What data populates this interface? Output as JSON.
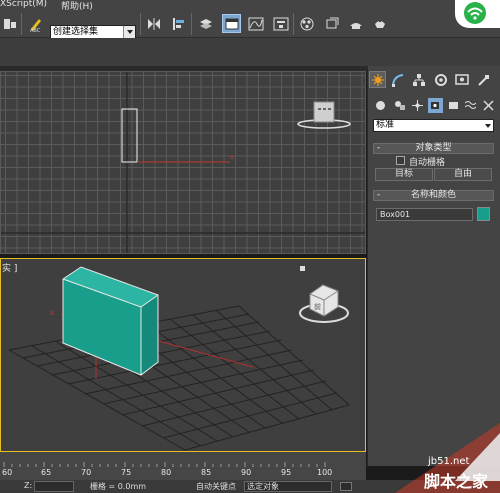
{
  "menu": {
    "items": [
      "XScript(M)",
      "帮助(H)"
    ]
  },
  "toolbar": {
    "selection_set_placeholder": "创建选择集"
  },
  "viewports": {
    "top": {
      "label": ""
    },
    "perspective": {
      "label": "实 ]"
    },
    "viewcube_label": "前"
  },
  "command_panel": {
    "category_dropdown": "标准",
    "object_type": {
      "title": "对象类型",
      "autogrid": "自动栅格",
      "buttons": [
        "目标",
        "自由"
      ]
    },
    "name_color": {
      "title": "名称和颜色",
      "name_value": "Box001",
      "color": "#1a9e8c"
    }
  },
  "timeline": {
    "ticks": [
      "60",
      "65",
      "70",
      "75",
      "80",
      "85",
      "90",
      "95",
      "100"
    ]
  },
  "status_bar": {
    "grid_label": "栅格 = 0.0mm",
    "autokey": "自动关键点",
    "selected_dropdown": "选定对象",
    "coord_label": "Z:"
  },
  "watermark": {
    "url": "jb51.net",
    "site": "脚本之家"
  },
  "colors": {
    "accent_yellow": "#e6c020",
    "box_teal": "#1a9e8c",
    "active_blue": "#7ba7d2"
  }
}
